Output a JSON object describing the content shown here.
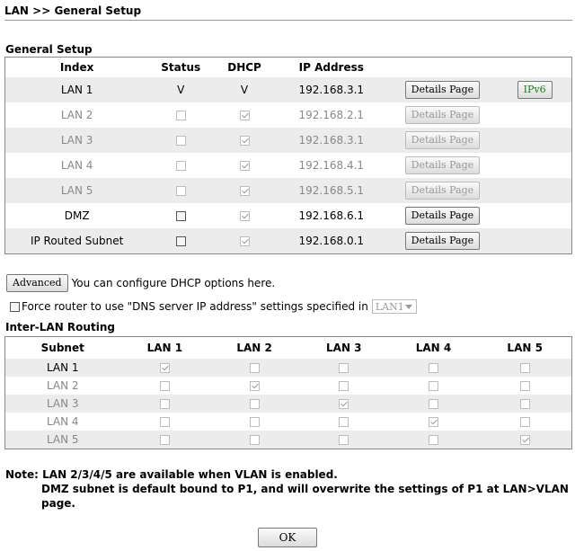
{
  "breadcrumb": "LAN >> General Setup",
  "general_setup": {
    "title": "General Setup",
    "headers": [
      "Index",
      "Status",
      "DHCP",
      "IP Address"
    ],
    "rows": [
      {
        "index": "LAN 1",
        "status": "V",
        "dhcp": "V",
        "ip": "192.168.3.1",
        "details": "Details Page",
        "ipv6": "IPv6"
      },
      {
        "index": "LAN 2",
        "ip": "192.168.2.1",
        "details": "Details Page"
      },
      {
        "index": "LAN 3",
        "ip": "192.168.3.1",
        "details": "Details Page"
      },
      {
        "index": "LAN 4",
        "ip": "192.168.4.1",
        "details": "Details Page"
      },
      {
        "index": "LAN 5",
        "ip": "192.168.5.1",
        "details": "Details Page"
      },
      {
        "index": "DMZ",
        "ip": "192.168.6.1",
        "details": "Details Page"
      },
      {
        "index": "IP Routed Subnet",
        "ip": "192.168.0.1",
        "details": "Details Page"
      }
    ]
  },
  "advanced": {
    "button": "Advanced",
    "text": "You can configure DHCP options here."
  },
  "dns": {
    "label": "Force router to use \"DNS server IP address\" settings specified in",
    "selected": "LAN1"
  },
  "inter_lan": {
    "title": "Inter-LAN Routing",
    "headers": [
      "Subnet",
      "LAN 1",
      "LAN 2",
      "LAN 3",
      "LAN 4",
      "LAN 5"
    ],
    "rows": [
      "LAN 1",
      "LAN 2",
      "LAN 3",
      "LAN 4",
      "LAN 5"
    ]
  },
  "note": {
    "line1": "Note: LAN 2/3/4/5 are available when VLAN is enabled.",
    "line2": "DMZ subnet is default bound to P1, and will overwrite the settings of P1 at LAN>VLAN",
    "line3": "page."
  },
  "ok_button": "OK"
}
